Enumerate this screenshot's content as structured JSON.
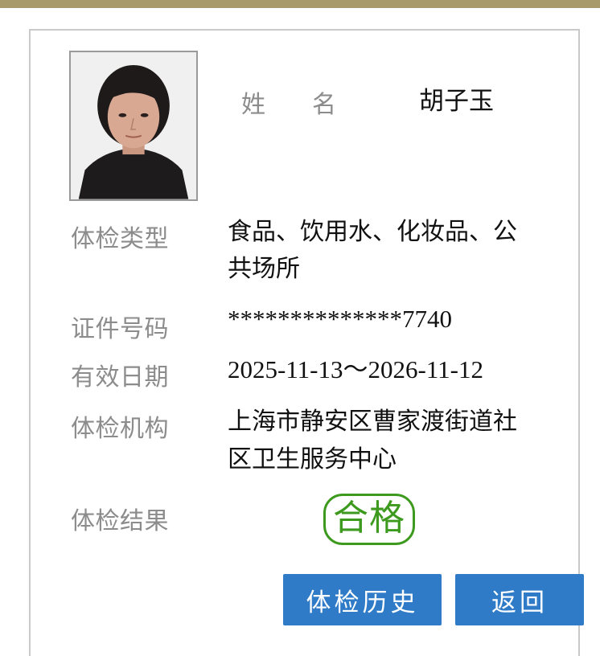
{
  "profile": {
    "name_label_part1": "姓",
    "name_label_part2": "名",
    "name_value": "胡子玉"
  },
  "fields": [
    {
      "label": "体检类型",
      "value_line1": "食品、饮用水、化妆品、公",
      "value_line2": "共场所"
    },
    {
      "label": "证件号码",
      "value": "**************7740"
    },
    {
      "label": "有效日期",
      "value": "2025-11-13～2026-11-12"
    },
    {
      "label": "体检机构",
      "value_line1": "上海市静安区曹家渡街道社",
      "value_line2": "区卫生服务中心"
    },
    {
      "label": "体检结果"
    }
  ],
  "result": {
    "text": "合格",
    "color": "#3d9a1f"
  },
  "buttons": {
    "history": "体检历史",
    "back": "返回"
  },
  "colors": {
    "accent_bar": "#a99a6c",
    "button": "#2f7bc7",
    "label": "#8c8c8c"
  }
}
